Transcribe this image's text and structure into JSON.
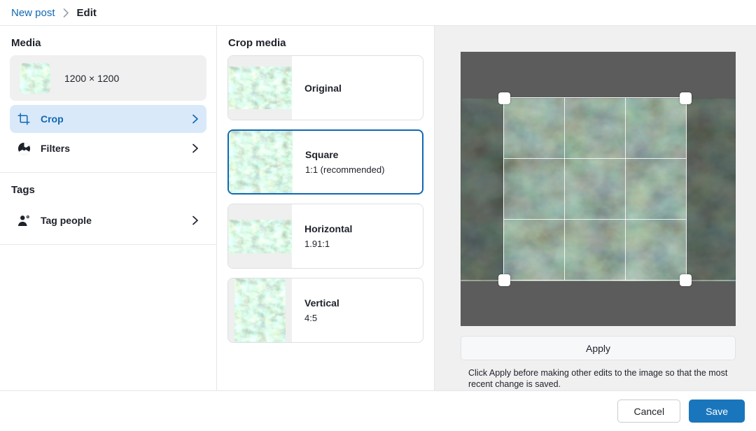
{
  "breadcrumb": {
    "parent": "New post",
    "separator": "chevron-right-icon",
    "current": "Edit"
  },
  "sidebar": {
    "media_heading": "Media",
    "media": {
      "dimensions": "1200 × 1200",
      "thumbnail": "succulent-thumbnail"
    },
    "items": [
      {
        "label": "Crop",
        "icon": "crop-icon",
        "active": true
      },
      {
        "label": "Filters",
        "icon": "aperture-icon",
        "active": false
      }
    ],
    "tags_heading": "Tags",
    "tag_items": [
      {
        "label": "Tag people",
        "icon": "tag-people-icon",
        "active": false
      }
    ]
  },
  "crop_panel": {
    "heading": "Crop media",
    "options": [
      {
        "name": "Original",
        "ratio": "",
        "selected": false
      },
      {
        "name": "Square",
        "ratio": "1:1 (recommended)",
        "selected": true
      },
      {
        "name": "Horizontal",
        "ratio": "1.91:1",
        "selected": false
      },
      {
        "name": "Vertical",
        "ratio": "4:5",
        "selected": false
      }
    ]
  },
  "preview": {
    "apply_label": "Apply",
    "note": "Click Apply before making other edits to the image so that the most recent change is saved.",
    "image_alt": "succulent-plants-photo",
    "letterbox_color": "#5c5c5c",
    "crop_guides": "rule-of-thirds"
  },
  "footer": {
    "cancel_label": "Cancel",
    "save_label": "Save"
  },
  "colors": {
    "accent": "#1168b3",
    "primary_button": "#1a76bc",
    "active_row_bg": "#d9e9f9",
    "panel_bg": "#f0f0f0",
    "border": "#e4e6e9"
  }
}
